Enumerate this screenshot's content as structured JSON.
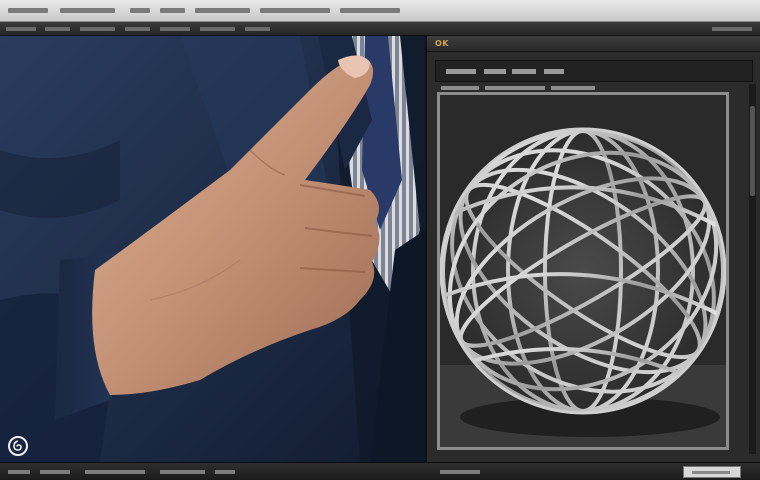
{
  "panel": {
    "title": "OK"
  },
  "watermark": {
    "icon": "spiral-logo-icon"
  },
  "colors": {
    "suit": "#1f3050",
    "skin": "#c79a7c",
    "tie_stripe": "#c9cbd2",
    "panel_bg": "#2b2b2b",
    "app_chrome_light": "#d4d4d4",
    "accent": "#d8a24a"
  }
}
